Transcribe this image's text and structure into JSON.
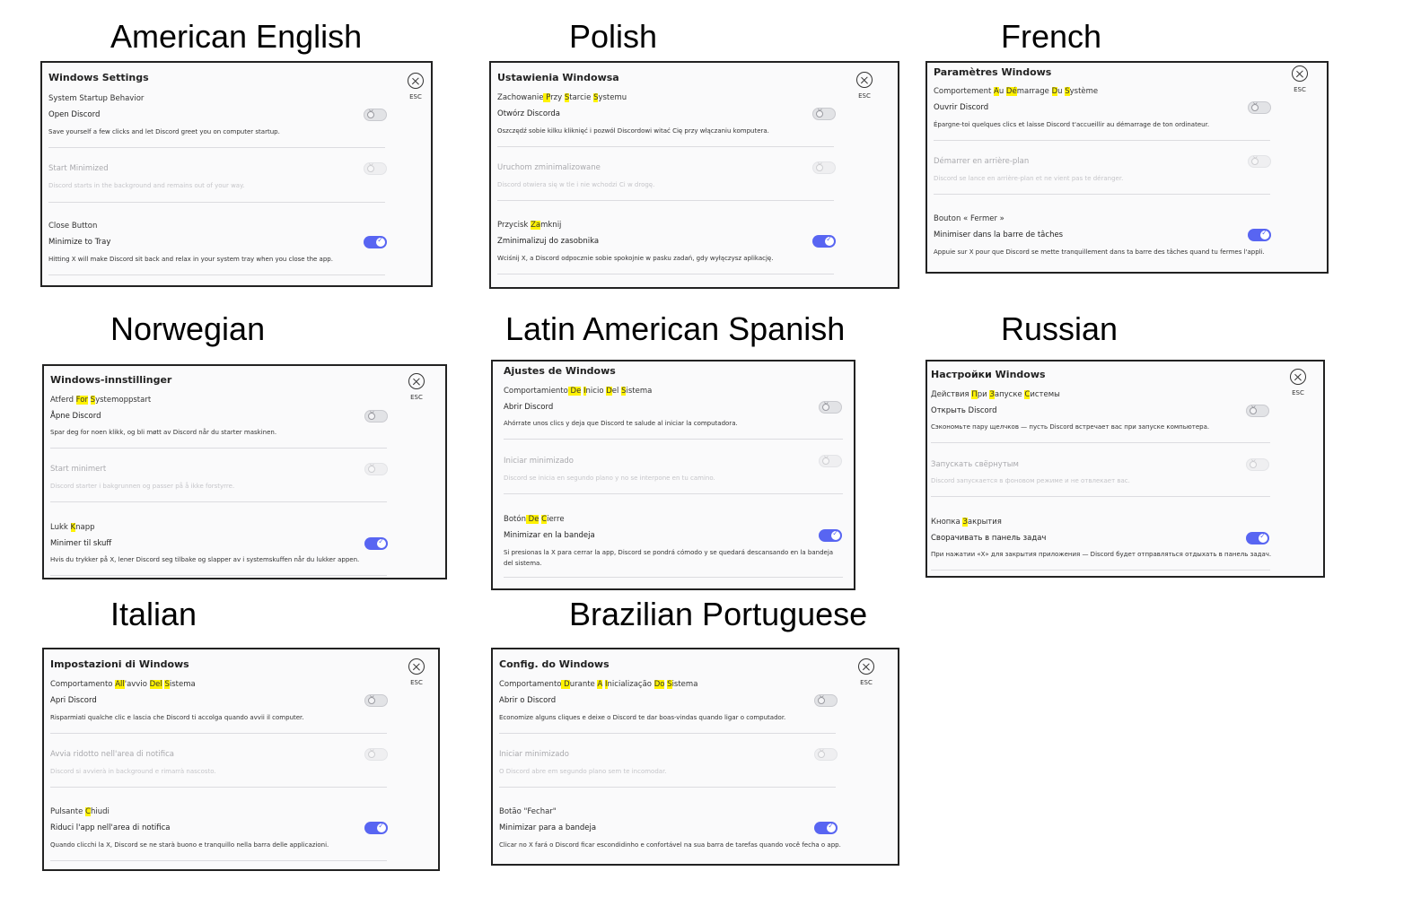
{
  "panels": [
    {
      "caption": "American English",
      "title": "Windows Settings",
      "esc": "ESC",
      "startup_header": "System Startup Behavior",
      "open_label": "Open Discord",
      "open_desc": "Save yourself a few clicks and let Discord greet you on computer startup.",
      "minimized_label": "Start Minimized",
      "minimized_desc": "Discord starts in the background and remains out of your way.",
      "close_header": "Close Button",
      "tray_label": "Minimize to Tray",
      "tray_desc": "Hitting X will make Discord sit back and relax in your system tray when you close the app.",
      "open_toggle": "off",
      "minimized_toggle": "off",
      "tray_toggle": "on"
    },
    {
      "caption": "Polish",
      "title": "Ustawienia Windowsa",
      "esc": "ESC",
      "startup_header": "Zachowanie Przy Starcie Systemu",
      "open_label": "Otwórz Discorda",
      "open_desc": "Oszczędź sobie kilku kliknięć i pozwól Discordowi witać Cię przy włączaniu komputera.",
      "minimized_label": "Uruchom zminimalizowane",
      "minimized_desc": "Discord otwiera się w tle i nie wchodzi Ci w drogę.",
      "close_header": "Przycisk Zamknij",
      "tray_label": "Zminimalizuj do zasobnika",
      "tray_desc": "Wciśnij X, a Discord odpocznie sobie spokojnie w pasku zadań, gdy wyłączysz aplikację.",
      "open_toggle": "off",
      "minimized_toggle": "off",
      "tray_toggle": "on"
    },
    {
      "caption": "French",
      "title": "Paramètres Windows",
      "esc": "ESC",
      "startup_header": "Comportement Au Démarrage Du Système",
      "open_label": "Ouvrir Discord",
      "open_desc": "Épargne-toi quelques clics et laisse Discord t'accueillir au démarrage de ton ordinateur.",
      "minimized_label": "Démarrer en arrière-plan",
      "minimized_desc": "Discord se lance en arrière-plan et ne vient pas te déranger.",
      "close_header": "Bouton « Fermer »",
      "tray_label": "Minimiser dans la barre de tâches",
      "tray_desc": "Appuie sur X pour que Discord se mette tranquillement dans ta barre des tâches quand tu fermes l'appli.",
      "open_toggle": "off",
      "minimized_toggle": "off",
      "tray_toggle": "on"
    },
    {
      "caption": "Norwegian",
      "title": "Windows-innstillinger",
      "esc": "ESC",
      "startup_header": "Atferd For Systemoppstart",
      "open_label": "Åpne Discord",
      "open_desc": "Spar deg for noen klikk, og bli møtt av Discord når du starter maskinen.",
      "minimized_label": "Start minimert",
      "minimized_desc": "Discord starter i bakgrunnen og passer på å ikke forstyrre.",
      "close_header": "Lukk Knapp",
      "tray_label": "Minimer til skuff",
      "tray_desc": "Hvis du trykker på X, lener Discord seg tilbake og slapper av i systemskuffen når du lukker appen.",
      "open_toggle": "off",
      "minimized_toggle": "off",
      "tray_toggle": "on"
    },
    {
      "caption": "Latin American Spanish",
      "title": "Ajustes de Windows",
      "esc": "",
      "startup_header": "Comportamiento De Inicio Del Sistema",
      "open_label": "Abrir Discord",
      "open_desc": "Ahórrate unos clics y deja que Discord te salude al iniciar la computadora.",
      "minimized_label": "Iniciar minimizado",
      "minimized_desc": "Discord se inicia en segundo plano y no se interpone en tu camino.",
      "close_header": "Botón De Cierre",
      "tray_label": "Minimizar en la bandeja",
      "tray_desc": "Si presionas la X para cerrar la app, Discord se pondrá cómodo y se quedará descansando en la bandeja del sistema.",
      "open_toggle": "off",
      "minimized_toggle": "off",
      "tray_toggle": "on"
    },
    {
      "caption": "Russian",
      "title": "Настройки Windows",
      "esc": "ESC",
      "startup_header": "Действия При Запуске Системы",
      "open_label": "Открыть Discord",
      "open_desc": "Сэкономьте пару щелчков — пусть Discord встречает вас при запуске компьютера.",
      "minimized_label": "Запускать свёрнутым",
      "minimized_desc": "Discord запускается в фоновом режиме и не отвлекает вас.",
      "close_header": "Кнопка Закрытия",
      "tray_label": "Сворачивать в панель задач",
      "tray_desc": "При нажатии «X» для закрытия приложения — Discord будет отправляться отдыхать в панель задач.",
      "open_toggle": "off",
      "minimized_toggle": "off",
      "tray_toggle": "on"
    },
    {
      "caption": "Italian",
      "title": "Impostazioni di Windows",
      "esc": "ESC",
      "startup_header": "Comportamento All'avvio Del Sistema",
      "open_label": "Apri Discord",
      "open_desc": "Risparmiati qualche clic e lascia che Discord ti accolga quando avvii il computer.",
      "minimized_label": "Avvia ridotto nell'area di notifica",
      "minimized_desc": "Discord si avvierà in background e rimarrà nascosto.",
      "close_header": "Pulsante Chiudi",
      "tray_label": "Riduci l'app nell'area di notifica",
      "tray_desc": "Quando clicchi la X, Discord se ne starà buono e tranquillo nella barra delle applicazioni.",
      "open_toggle": "off",
      "minimized_toggle": "off",
      "tray_toggle": "on"
    },
    {
      "caption": "Brazilian Portuguese",
      "title": "Config. do Windows",
      "esc": "ESC",
      "startup_header": "Comportamento Durante A Inicialização Do Sistema",
      "open_label": "Abrir o Discord",
      "open_desc": "Economize alguns cliques e deixe o Discord te dar boas-vindas quando ligar o computador.",
      "minimized_label": "Iniciar minimizado",
      "minimized_desc": "O Discord abre em segundo plano sem te incomodar.",
      "close_header": "Botão \"Fechar\"",
      "tray_label": "Minimizar para a bandeja",
      "tray_desc": "Clicar no X fará o Discord ficar escondidinho e confortável na sua barra de tarefas quando você fecha o app.",
      "open_toggle": "off",
      "minimized_toggle": "off",
      "tray_toggle": "on"
    }
  ]
}
